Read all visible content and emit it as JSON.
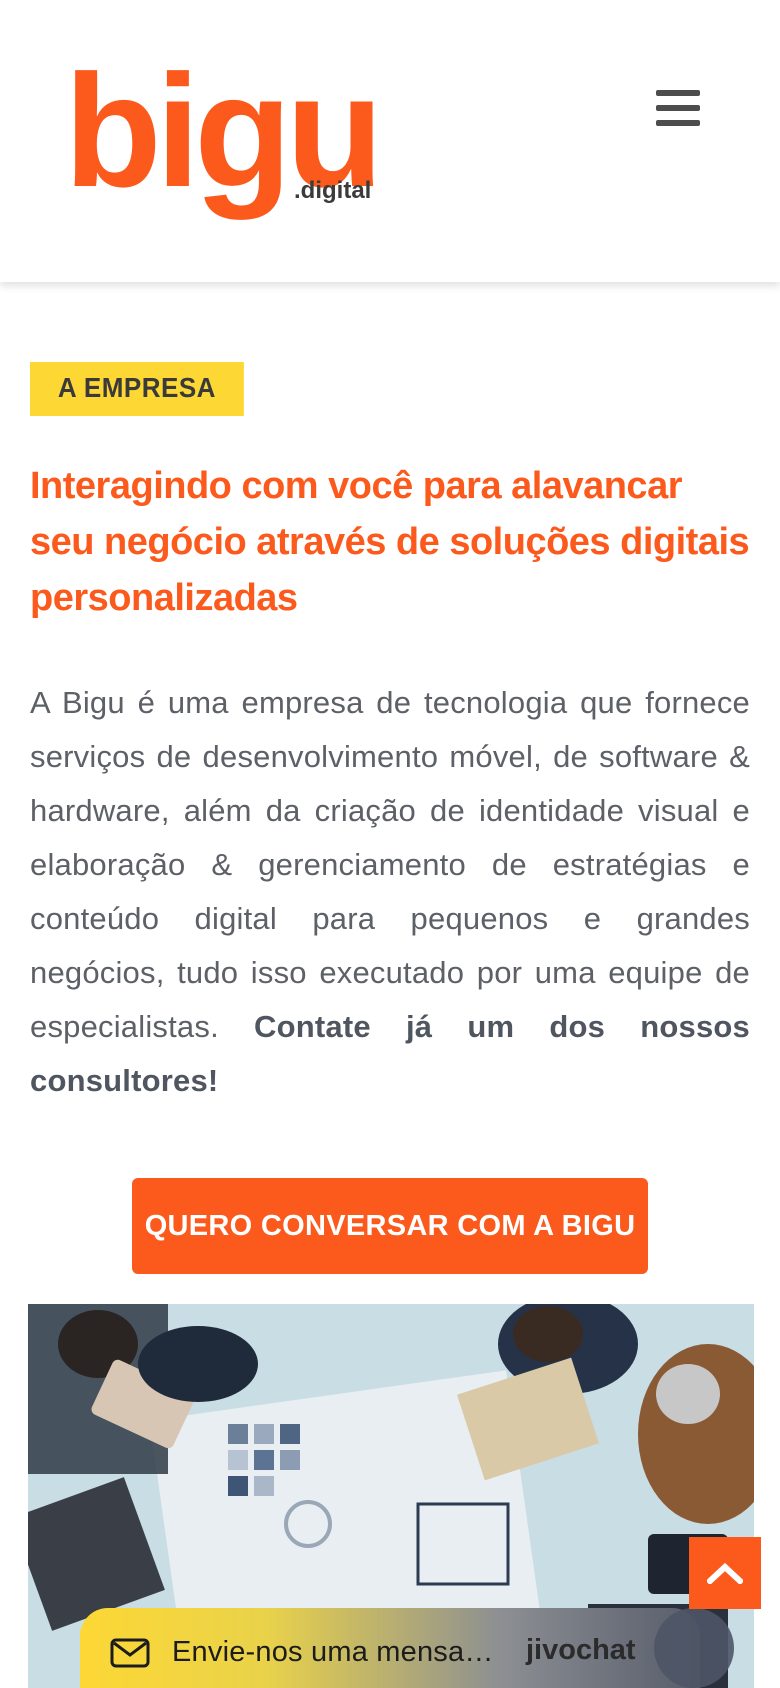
{
  "header": {
    "logo_text": "bigu",
    "logo_suffix": ".digital",
    "menu_icon": "hamburger-menu-icon"
  },
  "section": {
    "tag": "A EMPRESA",
    "title": "Interagindo com você para alavancar seu negócio através de soluções digitais personalizadas",
    "description": "A Bigu é uma empresa de tecnologia que fornece serviços de desenvolvimento móvel, de software & hardware, além da criação de identidade visual e elaboração & gerenciamento de estratégias e conteúdo digital para pequenos e grandes negócios, tudo isso executado por uma equipe de especialistas.",
    "description_bold": "Contate já um dos nossos consultores!"
  },
  "cta": {
    "label": "QUERO CONVERSAR COM A BIGU"
  },
  "chat": {
    "placeholder": "Envie-nos uma mensa…",
    "brand": "jivochat",
    "icon": "mail-icon"
  },
  "back_to_top": {
    "icon": "chevron-up-icon"
  },
  "colors": {
    "brand_orange": "#fb5a1c",
    "tag_yellow": "#fdd835",
    "text_gray": "#5d6066"
  }
}
